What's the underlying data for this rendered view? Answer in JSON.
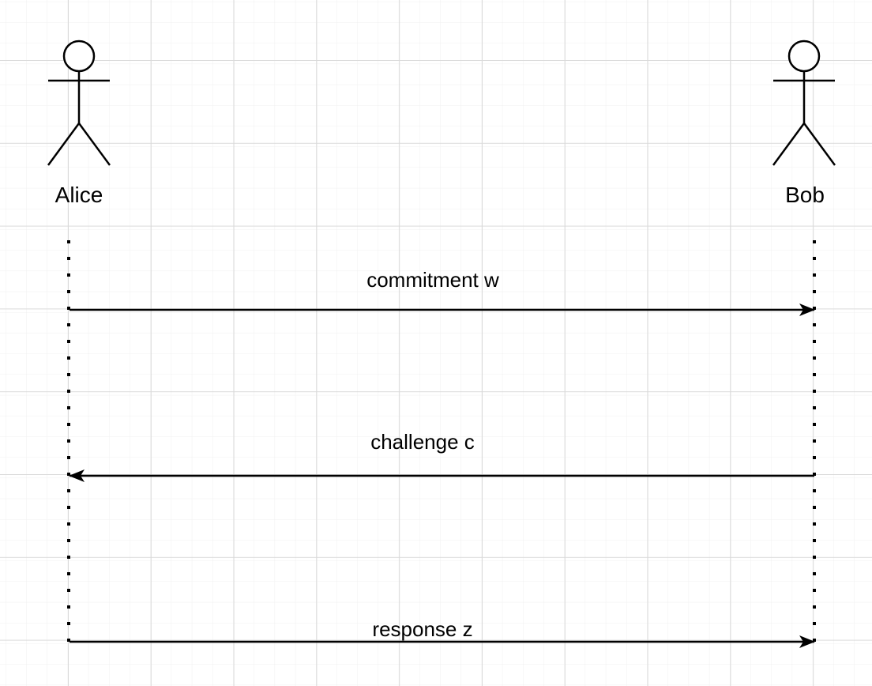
{
  "actors": [
    {
      "name": "Alice"
    },
    {
      "name": "Bob"
    }
  ],
  "messages": [
    {
      "label": "commitment w",
      "from": "Alice",
      "to": "Bob"
    },
    {
      "label": "challenge c",
      "from": "Bob",
      "to": "Alice"
    },
    {
      "label": "response z",
      "from": "Alice",
      "to": "Bob"
    }
  ],
  "colors": {
    "line": "#000000",
    "grid_minor": "#f0f0f0",
    "grid_major": "#dadada",
    "background": "#ffffff"
  }
}
